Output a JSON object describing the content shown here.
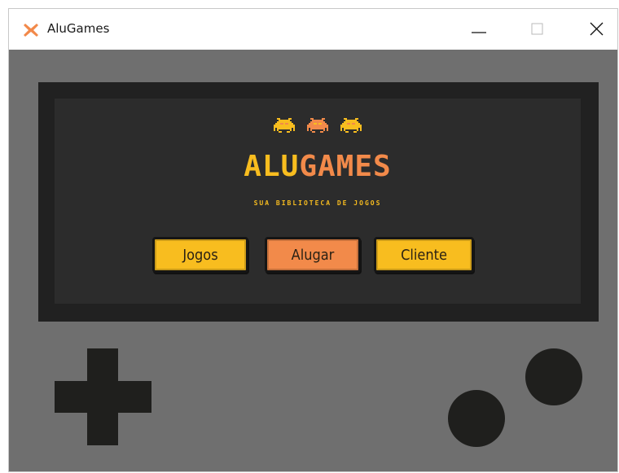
{
  "window": {
    "title": "AluGames",
    "icon": "x-logo-icon",
    "controls": [
      "minimize",
      "maximize",
      "close"
    ]
  },
  "screen": {
    "logo_part1": "ALU",
    "logo_part2": "GAMES",
    "subtitle": "SUA BIBLIOTECA DE JOGOS",
    "invader_icons": [
      "invader-icon",
      "invader-icon",
      "invader-icon"
    ]
  },
  "buttons": {
    "jogos": "Jogos",
    "alugar": "Alugar",
    "cliente": "Cliente"
  },
  "colors": {
    "yellow": "#f8bd1f",
    "orange": "#f28a4a",
    "screen_dark": "#212121",
    "body_gray": "#6f6f6f"
  }
}
